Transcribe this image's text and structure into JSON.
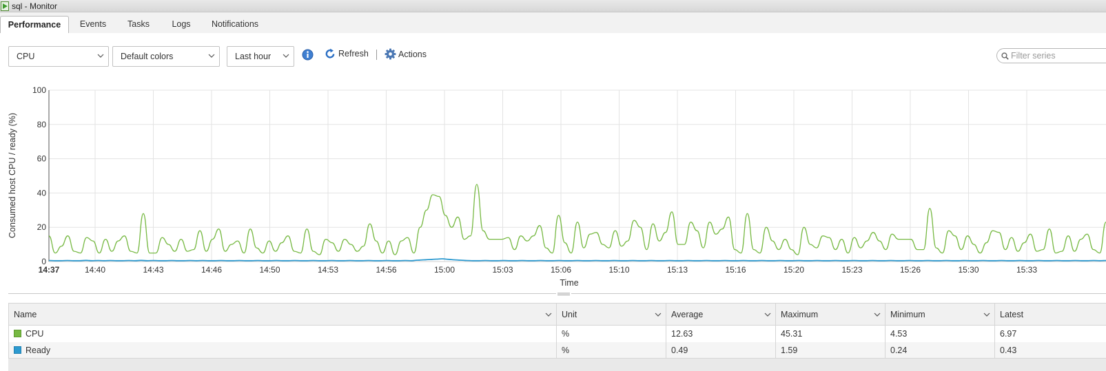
{
  "window": {
    "title": "sql - Monitor",
    "icon": "vm-play-icon"
  },
  "tabs": [
    {
      "label": "Performance",
      "active": true
    },
    {
      "label": "Events",
      "active": false
    },
    {
      "label": "Tasks",
      "active": false
    },
    {
      "label": "Logs",
      "active": false
    },
    {
      "label": "Notifications",
      "active": false
    }
  ],
  "toolbar": {
    "metric_select": "CPU",
    "color_select": "Default colors",
    "range_select": "Last hour",
    "info_icon": "info-icon",
    "refresh_label": "Refresh",
    "actions_label": "Actions",
    "filter_placeholder": "Filter series"
  },
  "chart_data": {
    "type": "line",
    "xlabel": "Time",
    "ylabel": "Consumed host CPU / ready (%)",
    "ylim": [
      0,
      100
    ],
    "yticks": [
      0,
      20,
      40,
      60,
      80,
      100
    ],
    "x_tick_labels": [
      "14:37",
      "14:40",
      "14:43",
      "14:46",
      "14:50",
      "14:53",
      "14:56",
      "15:00",
      "15:03",
      "15:06",
      "15:10",
      "15:13",
      "15:16",
      "15:20",
      "15:23",
      "15:26",
      "15:30",
      "15:33"
    ],
    "grid": true,
    "series": [
      {
        "name": "CPU",
        "color": "#77b943",
        "values": [
          15,
          5,
          9,
          15,
          6,
          5,
          14,
          12,
          5,
          13,
          6,
          12,
          15,
          6,
          5,
          28,
          5,
          5,
          14,
          10,
          6,
          13,
          6,
          7,
          18,
          6,
          13,
          19,
          6,
          10,
          12,
          5,
          19,
          8,
          5,
          12,
          6,
          11,
          15,
          6,
          5,
          19,
          6,
          4,
          13,
          11,
          6,
          13,
          10,
          6,
          9,
          22,
          12,
          5,
          12,
          4,
          12,
          14,
          5,
          20,
          30,
          39,
          38,
          27,
          20,
          26,
          13,
          15,
          45,
          18,
          13,
          13,
          13,
          14,
          7,
          15,
          12,
          15,
          21,
          8,
          5,
          27,
          11,
          5,
          23,
          8,
          16,
          17,
          10,
          8,
          18,
          9,
          12,
          24,
          20,
          7,
          22,
          12,
          17,
          29,
          10,
          10,
          23,
          18,
          8,
          23,
          16,
          19,
          26,
          7,
          5,
          28,
          7,
          5,
          20,
          12,
          7,
          13,
          7,
          4,
          20,
          10,
          8,
          15,
          14,
          7,
          13,
          5,
          14,
          8,
          12,
          17,
          12,
          7,
          16,
          13,
          13,
          13,
          7,
          7,
          31,
          8,
          5,
          18,
          15,
          7,
          15,
          10,
          5,
          11,
          18,
          17,
          7,
          14,
          6,
          11,
          16,
          6,
          7,
          19,
          5,
          6,
          15,
          6,
          13,
          16,
          7,
          5,
          23
        ]
      },
      {
        "name": "Ready",
        "color": "#2d9ad0",
        "values": [
          0.6,
          0.5,
          0.5,
          0.6,
          0.5,
          0.5,
          0.7,
          0.5,
          0.6,
          0.5,
          0.6,
          0.5,
          0.5,
          0.6,
          0.5,
          0.7,
          0.5,
          0.6,
          0.5,
          0.5,
          0.6,
          0.5,
          0.5,
          0.6,
          0.5,
          0.6,
          0.5,
          0.5,
          0.6,
          0.5,
          0.5,
          0.6,
          0.5,
          0.5,
          0.6,
          0.5,
          0.5,
          0.6,
          0.5,
          0.5,
          0.6,
          0.5,
          0.5,
          0.6,
          0.5,
          0.5,
          0.6,
          0.5,
          0.5,
          0.6,
          0.5,
          0.5,
          0.6,
          0.5,
          0.5,
          0.6,
          0.5,
          0.5,
          0.6,
          0.5,
          0.8,
          1.0,
          1.2,
          1.4,
          1.59,
          1.3,
          1.0,
          0.8,
          0.6,
          0.5,
          0.5,
          0.6,
          0.5,
          0.5,
          0.6,
          0.5,
          0.5,
          0.6,
          0.5,
          0.5,
          0.6,
          0.5,
          0.5,
          0.6,
          0.5,
          0.5,
          0.6,
          0.5,
          0.5,
          0.6,
          0.5,
          0.5,
          0.6,
          0.5,
          0.5,
          0.6,
          0.5,
          0.5,
          0.6,
          0.5,
          0.5,
          0.6,
          0.5,
          0.5,
          0.6,
          0.5,
          0.5,
          0.6,
          0.5,
          0.5,
          0.6,
          0.5,
          0.5,
          0.6,
          0.5,
          0.5,
          0.6,
          0.5,
          0.5,
          0.6,
          0.5,
          0.5,
          0.6,
          0.5,
          0.5,
          0.6,
          0.5,
          0.5,
          0.6,
          0.5,
          0.5,
          0.6,
          0.5,
          0.5,
          0.6,
          0.5,
          0.5,
          0.6,
          0.5,
          0.5,
          0.6,
          0.5,
          0.5,
          0.6,
          0.5,
          0.5,
          0.6,
          0.5,
          0.5,
          0.6,
          0.5,
          0.5,
          0.6,
          0.5,
          0.5,
          0.6,
          0.5,
          0.5,
          0.6,
          0.5,
          0.5,
          0.6,
          0.5,
          0.5,
          0.6,
          0.5,
          0.5,
          0.6,
          0.5,
          0.5,
          0.6,
          0.5,
          0.6
        ]
      }
    ]
  },
  "table": {
    "columns": [
      "Name",
      "Unit",
      "Average",
      "Maximum",
      "Minimum",
      "Latest"
    ],
    "rows": [
      {
        "name": "CPU",
        "color": "#77b943",
        "unit": "%",
        "average": "12.63",
        "maximum": "45.31",
        "minimum": "4.53",
        "latest": "6.97"
      },
      {
        "name": "Ready",
        "color": "#2d9ad0",
        "unit": "%",
        "average": "0.49",
        "maximum": "1.59",
        "minimum": "0.24",
        "latest": "0.43"
      }
    ]
  }
}
